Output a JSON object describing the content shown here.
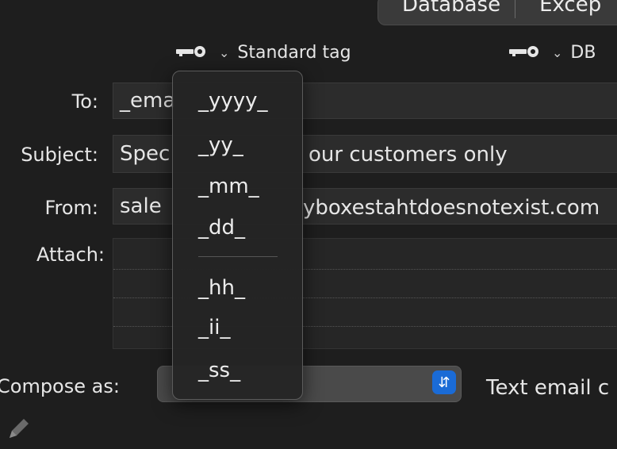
{
  "tabs": [
    "Database",
    "Excep"
  ],
  "tag_buttons": {
    "standard": {
      "label": "Standard tag",
      "icon": "key-icon"
    },
    "db": {
      "label": "DB",
      "icon": "key-icon"
    }
  },
  "form": {
    "to": {
      "label": "To:",
      "value": "_ema"
    },
    "subject": {
      "label": "Subject:",
      "value": "Spec",
      "value_tail": "our customers only"
    },
    "from": {
      "label": "From:",
      "value": "sale",
      "value_tail": "yboxestahtdoesnotexist.com"
    },
    "attach": {
      "label": "Attach:"
    }
  },
  "compose": {
    "label": "Compose as:",
    "option": "Text email c"
  },
  "menu": {
    "items": [
      "_yyyy_",
      "_yy_",
      "_mm_",
      "_dd_",
      "_hh_",
      "_ii_",
      "_ss_"
    ]
  },
  "colors": {
    "accent": "#1a6bd6",
    "background": "#1e1e1e"
  }
}
